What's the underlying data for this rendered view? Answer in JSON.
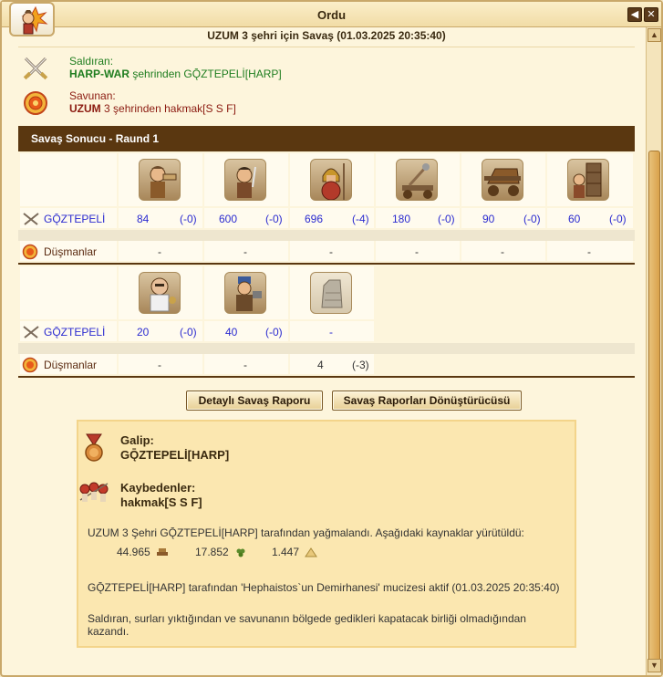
{
  "window": {
    "title": "Ordu",
    "subtitle": "UZUM 3 şehri için Savaş (01.03.2025 20:35:40)"
  },
  "attacker": {
    "role_label": "Saldıran:",
    "city": "HARP-WAR",
    "connector": "şehrinden",
    "player": "GǬZTEPELİ[HARP]"
  },
  "defender": {
    "role_label": "Savunan:",
    "city_name": "UZUM",
    "city_num": "3",
    "connector": "şehrinden",
    "player": "hakmak[S S F]"
  },
  "section": {
    "title": "Savaş Sonucu - Raund 1"
  },
  "rows": {
    "own_label": "GǬZTEPELİ",
    "enemy_label": "Düşmanlar"
  },
  "group1": {
    "units": [
      {
        "icon": "slinger-icon",
        "count": "84",
        "loss": "(-0)",
        "enemy": "-"
      },
      {
        "icon": "swordsman-icon",
        "count": "600",
        "loss": "(-0)",
        "enemy": "-"
      },
      {
        "icon": "hoplite-icon",
        "count": "696",
        "loss": "(-4)",
        "enemy": "-"
      },
      {
        "icon": "catapult-icon",
        "count": "180",
        "loss": "(-0)",
        "enemy": "-"
      },
      {
        "icon": "battering-ram-icon",
        "count": "90",
        "loss": "(-0)",
        "enemy": "-"
      },
      {
        "icon": "siege-tower-icon",
        "count": "60",
        "loss": "(-0)",
        "enemy": "-"
      }
    ]
  },
  "group2": {
    "units": [
      {
        "icon": "cook-icon",
        "count": "20",
        "loss": "(-0)",
        "enemy": "-",
        "enemy_loss": ""
      },
      {
        "icon": "blacksmith-icon",
        "count": "40",
        "loss": "(-0)",
        "enemy": "-",
        "enemy_loss": ""
      },
      {
        "icon": "wall-icon",
        "count": "-",
        "loss": "",
        "enemy": "4",
        "enemy_loss": "(-3)"
      }
    ]
  },
  "buttons": {
    "detailed": "Detaylı Savaş Raporu",
    "converter": "Savaş Raporları Dönüştürücüsü"
  },
  "result": {
    "winner_label": "Galip:",
    "winner_name": "GǬZTEPELİ[HARP]",
    "losers_label": "Kaybedenler:",
    "losers_name": "hakmak[S S F]",
    "plunder_text": "UZUM 3 Şehri GǬZTEPELİ[HARP] tarafından yağmalandı. Aşağıdaki kaynaklar yürütüldü:",
    "resources": [
      {
        "amount": "44.965",
        "icon": "wood-icon"
      },
      {
        "amount": "17.852",
        "icon": "grapes-icon"
      },
      {
        "amount": "1.447",
        "icon": "stone-icon"
      }
    ],
    "wonder_text": "GǬZTEPELİ[HARP] tarafından 'Hephaistos`un Demirhanesi' mucizesi aktif (01.03.2025 20:35:40)",
    "outcome_text": "Saldıran, surları yıktığından ve savunanın bölgede gedikleri kapatacak birliği olmadığından kazandı."
  },
  "colors": {
    "header_bar": "#5a3710",
    "count_text": "#2b2bd0",
    "attacker_green": "#1f7d1f",
    "defender_red": "#8b1a10"
  }
}
